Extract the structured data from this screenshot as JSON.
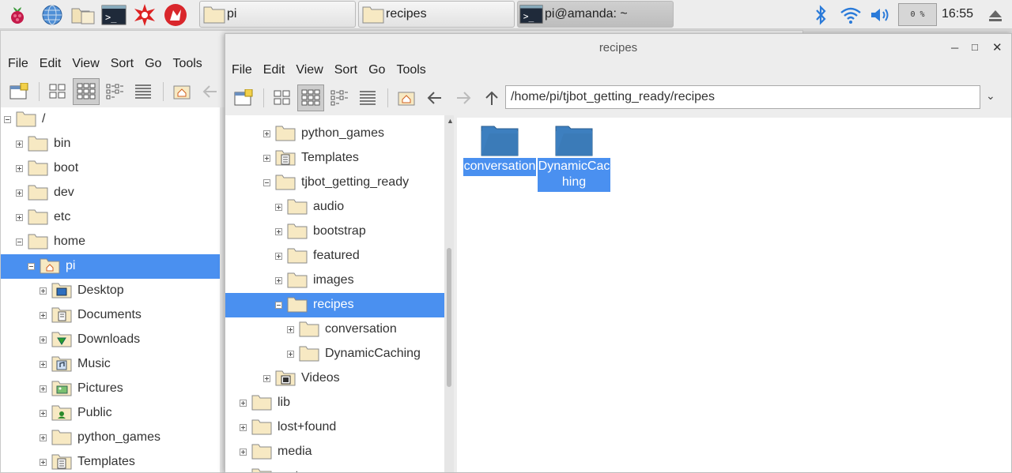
{
  "taskbar": {
    "tasks": [
      {
        "label": "pi"
      },
      {
        "label": "recipes"
      },
      {
        "label": "pi@amanda: ~"
      }
    ],
    "cpu": "0 %",
    "clock": "16:55"
  },
  "back_window": {
    "menu": [
      "File",
      "Edit",
      "View",
      "Sort",
      "Go",
      "Tools"
    ],
    "tree": [
      {
        "label": "/",
        "icon": "folder-icon"
      },
      {
        "label": "bin",
        "icon": "folder-icon"
      },
      {
        "label": "boot",
        "icon": "folder-icon"
      },
      {
        "label": "dev",
        "icon": "folder-icon"
      },
      {
        "label": "etc",
        "icon": "folder-icon"
      },
      {
        "label": "home",
        "icon": "folder-icon"
      },
      {
        "label": "pi",
        "icon": "home-folder-icon"
      },
      {
        "label": "Desktop",
        "icon": "desktop-folder-icon"
      },
      {
        "label": "Documents",
        "icon": "documents-folder-icon"
      },
      {
        "label": "Downloads",
        "icon": "downloads-folder-icon"
      },
      {
        "label": "Music",
        "icon": "music-folder-icon"
      },
      {
        "label": "Pictures",
        "icon": "pictures-folder-icon"
      },
      {
        "label": "Public",
        "icon": "public-folder-icon"
      },
      {
        "label": "python_games",
        "icon": "folder-icon"
      },
      {
        "label": "Templates",
        "icon": "templates-folder-icon"
      }
    ]
  },
  "front_window": {
    "title": "recipes",
    "menu": [
      "File",
      "Edit",
      "View",
      "Sort",
      "Go",
      "Tools"
    ],
    "location": "/home/pi/tjbot_getting_ready/recipes",
    "tree": [
      {
        "label": "python_games"
      },
      {
        "label": "Templates"
      },
      {
        "label": "tjbot_getting_ready"
      },
      {
        "label": "audio"
      },
      {
        "label": "bootstrap"
      },
      {
        "label": "featured"
      },
      {
        "label": "images"
      },
      {
        "label": "recipes"
      },
      {
        "label": "conversation"
      },
      {
        "label": "DynamicCaching"
      },
      {
        "label": "Videos"
      },
      {
        "label": "lib"
      },
      {
        "label": "lost+found"
      },
      {
        "label": "media"
      },
      {
        "label": "mnt"
      }
    ],
    "files": [
      {
        "label": "conversation"
      },
      {
        "label": "DynamicCaching"
      }
    ]
  },
  "colors": {
    "selection": "#4a90f0",
    "folder_fill": "#f7e9c3",
    "folder_blue": "#3d7fbf"
  }
}
